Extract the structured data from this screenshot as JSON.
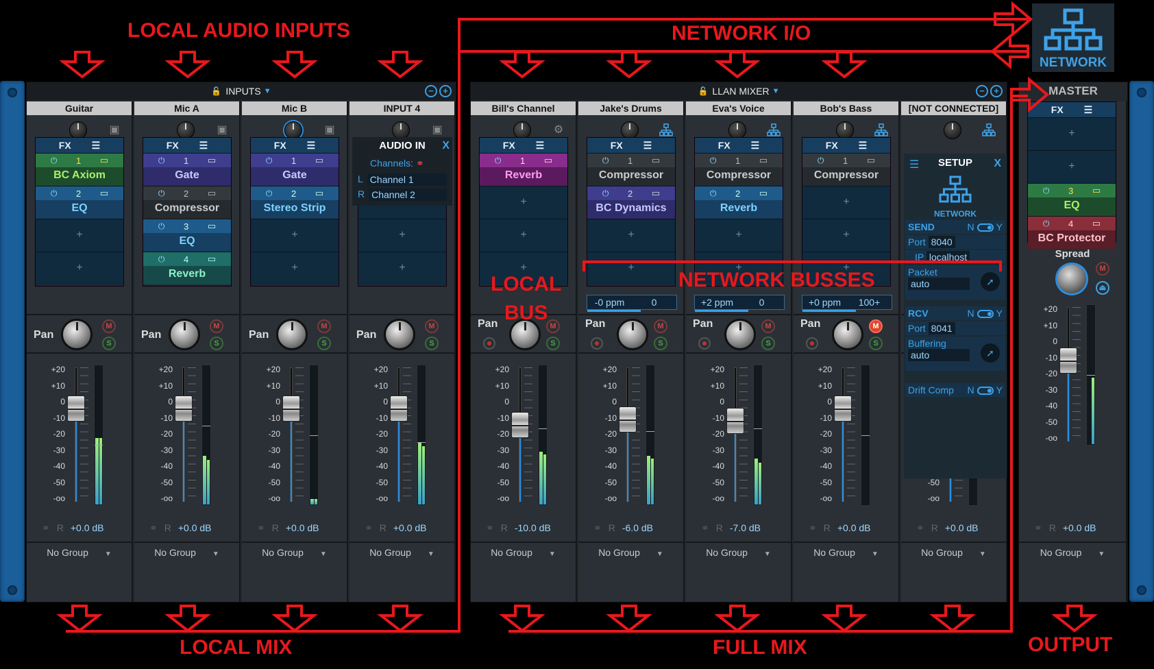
{
  "annotations": {
    "local_audio_inputs": "LOCAL AUDIO INPUTS",
    "network_io": "NETWORK I/O",
    "local_bus": "LOCAL\nBUS",
    "network_busses": "NETWORK BUSSES",
    "local_mix": "LOCAL MIX",
    "full_mix": "FULL MIX",
    "output": "OUTPUT",
    "network_button": "NETWORK"
  },
  "inputs_panel": {
    "title": "INPUTS",
    "channels": [
      {
        "name": "Guitar",
        "fx": [
          {
            "n": "1",
            "name": "BC Axiom",
            "color": "green"
          },
          {
            "n": "2",
            "name": "EQ",
            "color": "blue"
          }
        ],
        "gain_db": "+0.0 dB",
        "group": "No Group",
        "fader_pos": 0.21,
        "meter": [
          0.48,
          0.48
        ],
        "peak": 0.57
      },
      {
        "name": "Mic A",
        "fx": [
          {
            "n": "1",
            "name": "Gate",
            "color": "purple"
          },
          {
            "n": "2",
            "name": "Compressor",
            "color": "gray"
          },
          {
            "n": "3",
            "name": "EQ",
            "color": "blue"
          },
          {
            "n": "4",
            "name": "Reverb",
            "color": "teal"
          }
        ],
        "gain_db": "+0.0 dB",
        "group": "No Group",
        "fader_pos": 0.21,
        "meter": [
          0.35,
          0.32
        ],
        "peak": 0.43
      },
      {
        "name": "Mic B",
        "fx": [
          {
            "n": "1",
            "name": "Gate",
            "color": "purple"
          },
          {
            "n": "2",
            "name": "Stereo Strip",
            "color": "blue"
          }
        ],
        "gain_db": "+0.0 dB",
        "group": "No Group",
        "fader_pos": 0.21,
        "meter": [
          0.04,
          0.04
        ],
        "peak": 0.5
      },
      {
        "name": "INPUT 4",
        "audio_in": {
          "title": "AUDIO IN",
          "close": "X",
          "channels_label": "Channels:",
          "l_label": "L",
          "l_value": "Channel 1",
          "r_label": "R",
          "r_value": "Channel 2"
        },
        "gain_db": "+0.0 dB",
        "group": "No Group",
        "fader_pos": 0.21,
        "meter": [
          0.45,
          0.42
        ],
        "peak": 0.55
      }
    ]
  },
  "mixer_panel": {
    "title": "LLAN MIXER",
    "channels": [
      {
        "name": "Bill's Channel",
        "fx": [
          {
            "n": "1",
            "name": "Reverb",
            "color": "magenta"
          }
        ],
        "gain_db": "-10.0 dB",
        "group": "No Group",
        "fader_pos": 0.33,
        "meter": [
          0.38,
          0.36
        ],
        "peak": 0.45,
        "icon": "gear-icon"
      },
      {
        "name": "Jake's Drums",
        "fx": [
          {
            "n": "1",
            "name": "Compressor",
            "color": "gray"
          },
          {
            "n": "2",
            "name": "BC Dynamics",
            "color": "purple"
          }
        ],
        "ppm": "-0 ppm",
        "ppm_val": "0",
        "gain_db": "-6.0 dB",
        "group": "No Group",
        "fader_pos": 0.29,
        "meter": [
          0.35,
          0.33
        ],
        "peak": 0.47,
        "icon": "network-icon"
      },
      {
        "name": "Eva's Voice",
        "fx": [
          {
            "n": "1",
            "name": "Compressor",
            "color": "gray"
          },
          {
            "n": "2",
            "name": "Reverb",
            "color": "blue"
          }
        ],
        "ppm": "+2 ppm",
        "ppm_val": "0",
        "gain_db": "-7.0 dB",
        "group": "No Group",
        "fader_pos": 0.3,
        "meter": [
          0.33,
          0.3
        ],
        "peak": 0.45,
        "icon": "network-icon"
      },
      {
        "name": "Bob's Bass",
        "fx": [
          {
            "n": "1",
            "name": "Compressor",
            "color": "gray"
          }
        ],
        "ppm": "+0 ppm",
        "ppm_val": "100+",
        "gain_db": "+0.0 dB",
        "group": "No Group",
        "fader_pos": 0.21,
        "meter": [
          0.0,
          0.0
        ],
        "peak": 0.5,
        "icon": "network-icon"
      },
      {
        "name": "[NOT CONNECTED]",
        "gain_db": "+0.0 dB",
        "group": "No Group",
        "fader_pos": 0.21,
        "meter": [
          0.0,
          0.0
        ],
        "peak": 0.5,
        "icon": "network-icon",
        "setup": {
          "title": "SETUP",
          "close": "X",
          "network": "NETWORK",
          "send": "SEND",
          "n": "N",
          "y": "Y",
          "port_label": "Port",
          "send_port": "8040",
          "ip_label": "IP",
          "ip": "localhost",
          "packet_label": "Packet",
          "packet_value": "auto",
          "rcv": "RCV",
          "rcv_port": "8041",
          "buffering_label": "Buffering",
          "buffering_value": "auto",
          "drift_label": "Drift Comp"
        }
      }
    ]
  },
  "master": {
    "title": "MASTER",
    "fx_label": "FX",
    "fx": [
      {
        "n": "3",
        "name": "EQ",
        "color": "green"
      },
      {
        "n": "4",
        "name": "BC Protector",
        "color": "red"
      }
    ],
    "spread_label": "Spread",
    "gain_db": "+0.0 dB",
    "group": "No Group",
    "fader_pos": 0.3,
    "meter": [
      0.0,
      0.48
    ],
    "peak": 0.5
  },
  "common": {
    "fx_label": "FX",
    "pan_label": "Pan",
    "m": "M",
    "s": "S",
    "r": "R",
    "scale": [
      "+20",
      "+10",
      "0",
      "-10",
      "-20",
      "-30",
      "-40",
      "-50",
      "-oo"
    ]
  }
}
